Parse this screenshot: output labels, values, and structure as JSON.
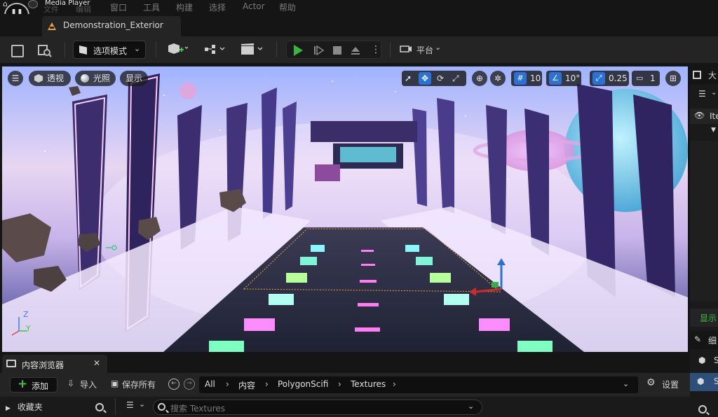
{
  "app": {
    "menu": {
      "items": [
        "文件",
        "编辑",
        "窗口",
        "工具",
        "构建",
        "选择",
        "Actor",
        "帮助"
      ]
    },
    "media_player_label": "Media Player",
    "document_tab": "Demonstration_Exterior"
  },
  "toolbar": {
    "mode_select": "选项模式",
    "platform": "平台"
  },
  "viewport": {
    "perspective": "透视",
    "lit": "光照",
    "show": "显示",
    "grid_snap": "10",
    "rotation_snap": "10°",
    "scale_snap": "0.25",
    "camera_speed": "1",
    "axis_z": "Z",
    "axis_y": "Y"
  },
  "right_panel": {
    "outliner_label": "大",
    "item_label_label": "Ite",
    "show_label": "显示",
    "details_label": "细",
    "actor_s1": "S",
    "actor_s2": "S"
  },
  "content_browser": {
    "tab_label": "内容浏览器",
    "add": "添加",
    "import": "导入",
    "save_all": "保存所有",
    "breadcrumb": [
      "All",
      "内容",
      "PolygonScifi",
      "Textures"
    ],
    "settings": "设置",
    "favorites": "收藏夹",
    "search_placeholder": "搜索 Textures"
  },
  "colors": {
    "accent_play": "#38b639",
    "accent_add": "#3ec43e",
    "tab_warning": "#e8a33a",
    "selection_blue": "#2b72d8"
  }
}
